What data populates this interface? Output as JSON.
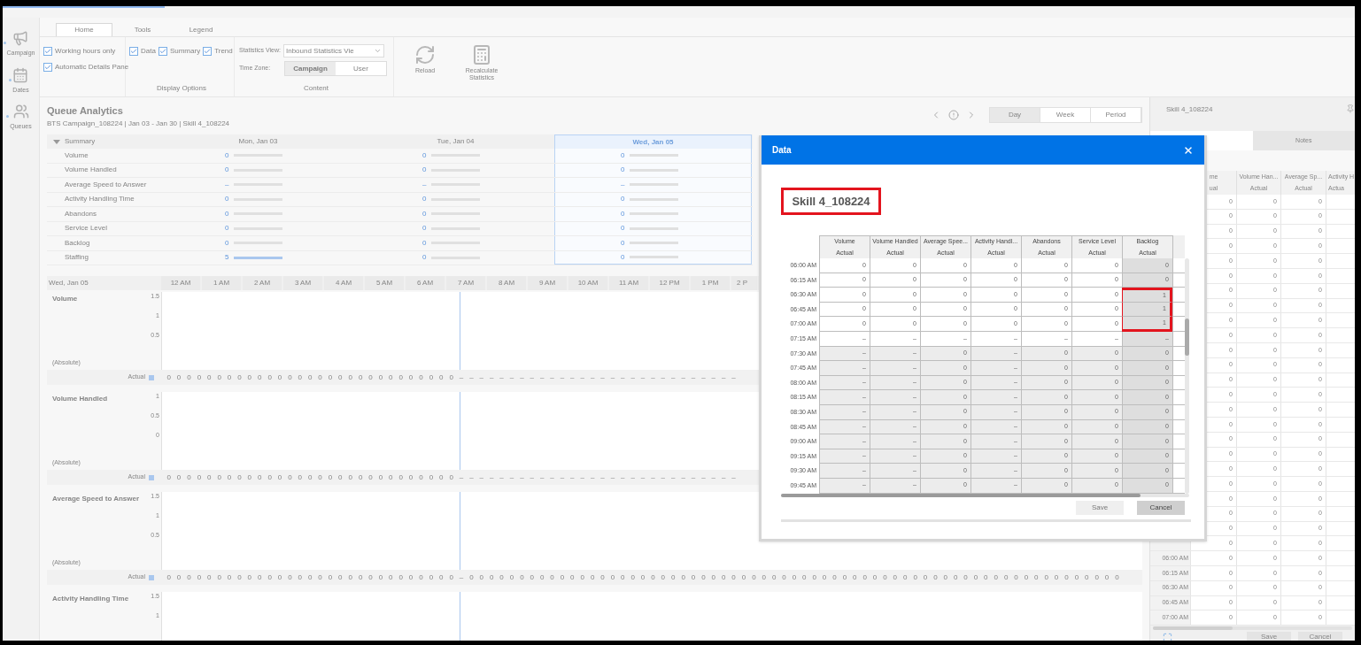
{
  "loading_bar": {
    "level": 0.12
  },
  "rail": [
    {
      "label": "Campaign",
      "kind": "campaign"
    },
    {
      "label": "Dates",
      "kind": "dates"
    },
    {
      "label": "Queues",
      "kind": "queues"
    }
  ],
  "ribbon": {
    "tabs": [
      {
        "label": "Home",
        "selected": true
      },
      {
        "label": "Tools",
        "selected": false
      },
      {
        "label": "Legend",
        "selected": false
      }
    ],
    "options": [
      {
        "label": "Working hours only",
        "checked": true
      },
      {
        "label": "Automatic Details Pane",
        "checked": true
      }
    ],
    "display_options": {
      "label": "Display Options",
      "items": [
        {
          "label": "Data",
          "checked": true
        },
        {
          "label": "Summary",
          "checked": true
        },
        {
          "label": "Trend",
          "checked": true
        }
      ]
    },
    "content": {
      "label": "Content",
      "statistics_view": {
        "label": "Statistics View:",
        "value": "Inbound Statistics Vie"
      },
      "time_zone": {
        "label": "Time Zone:",
        "options": [
          {
            "label": "Campaign",
            "selected": true
          },
          {
            "label": "User",
            "selected": false
          }
        ]
      }
    },
    "actions": [
      {
        "label": "Reload",
        "kind": "reload"
      },
      {
        "label": "Recalculate Statistics",
        "kind": "recalculate"
      }
    ]
  },
  "page": {
    "title": "Queue Analytics",
    "subtitle": "BTS Campaign_108224 | Jan 03 - Jan 30 | Skill 4_108224",
    "periods": [
      {
        "label": "Day",
        "selected": true
      },
      {
        "label": "Week",
        "selected": false
      },
      {
        "label": "Period",
        "selected": false
      }
    ]
  },
  "summary": {
    "label": "Summary",
    "expanded": true,
    "days": [
      {
        "label": "Mon, Jan 03",
        "selected": false
      },
      {
        "label": "Tue, Jan 04",
        "selected": false
      },
      {
        "label": "Wed, Jan 05",
        "selected": true
      }
    ],
    "rows": [
      {
        "label": "Volume",
        "cells": [
          {
            "value": "0",
            "level": 0
          },
          {
            "value": "0",
            "level": 0
          },
          {
            "value": "0",
            "level": 0
          }
        ]
      },
      {
        "label": "Volume Handled",
        "cells": [
          {
            "value": "0",
            "level": 0
          },
          {
            "value": "0",
            "level": 0
          },
          {
            "value": "0",
            "level": 0
          }
        ]
      },
      {
        "label": "Average Speed to Answer",
        "cells": [
          {
            "value": "–",
            "level": 0
          },
          {
            "value": "–",
            "level": 0
          },
          {
            "value": "–",
            "level": 0
          }
        ]
      },
      {
        "label": "Activity Handling Time",
        "cells": [
          {
            "value": "0",
            "level": 0
          },
          {
            "value": "0",
            "level": 0
          },
          {
            "value": "0",
            "level": 0
          }
        ]
      },
      {
        "label": "Abandons",
        "cells": [
          {
            "value": "0",
            "level": 0
          },
          {
            "value": "0",
            "level": 0
          },
          {
            "value": "0",
            "level": 0
          }
        ]
      },
      {
        "label": "Service Level",
        "cells": [
          {
            "value": "0",
            "level": 0
          },
          {
            "value": "0",
            "level": 0
          },
          {
            "value": "0",
            "level": 0
          }
        ]
      },
      {
        "label": "Backlog",
        "cells": [
          {
            "value": "0",
            "level": 0
          },
          {
            "value": "0",
            "level": 0
          },
          {
            "value": "0",
            "level": 0
          }
        ]
      },
      {
        "label": "Staffing",
        "cells": [
          {
            "value": "5",
            "level": 1
          },
          {
            "value": "0",
            "level": 0
          },
          {
            "value": "0",
            "level": 0
          }
        ]
      }
    ]
  },
  "timeline": {
    "date": "Wed, Jan 05",
    "hours": [
      "12 AM",
      "1 AM",
      "2 AM",
      "3 AM",
      "4 AM",
      "5 AM",
      "6 AM",
      "7 AM",
      "8 AM",
      "9 AM",
      "10 AM",
      "11 AM",
      "12 PM",
      "1 PM",
      "2 P"
    ],
    "charts": [
      {
        "title": "Volume",
        "scale": "(Absolute)",
        "ticks": [
          "1.5",
          "1",
          "0.5"
        ],
        "actual_label": "Actual",
        "actual": [
          "0",
          "0",
          "0",
          "0",
          "0",
          "0",
          "0",
          "0",
          "0",
          "0",
          "0",
          "0",
          "0",
          "0",
          "0",
          "0",
          "0",
          "0",
          "0",
          "0",
          "0",
          "0",
          "0",
          "0",
          "0",
          "0",
          "0",
          "0",
          "0",
          "–",
          "–",
          "–",
          "–",
          "–",
          "–",
          "–",
          "–",
          "–",
          "–",
          "–",
          "–",
          "–",
          "–",
          "–",
          "–",
          "–",
          "–",
          "–",
          "–",
          "–",
          "–",
          "–",
          "–",
          "–",
          "–",
          "–",
          "–"
        ]
      },
      {
        "title": "Volume Handled",
        "scale": "(Absolute)",
        "ticks": [
          "1",
          "0.5",
          "0"
        ],
        "actual_label": "Actual",
        "actual": [
          "0",
          "0",
          "0",
          "0",
          "0",
          "0",
          "0",
          "0",
          "0",
          "0",
          "0",
          "0",
          "0",
          "0",
          "0",
          "0",
          "0",
          "0",
          "0",
          "0",
          "0",
          "0",
          "0",
          "0",
          "0",
          "0",
          "0",
          "0",
          "0",
          "–",
          "–",
          "–",
          "–",
          "–",
          "–",
          "–",
          "–",
          "–",
          "–",
          "–",
          "–",
          "–",
          "–",
          "–",
          "–",
          "–",
          "–",
          "–",
          "–",
          "–",
          "–",
          "–",
          "–",
          "–",
          "–",
          "–",
          "–"
        ]
      },
      {
        "title": "Average Speed to Answer",
        "scale": "(Absolute)",
        "ticks": [
          "1.5",
          "1",
          "0.5"
        ],
        "actual_label": "Actual",
        "actual": [
          "0",
          "0",
          "0",
          "0",
          "0",
          "0",
          "0",
          "0",
          "0",
          "0",
          "0",
          "0",
          "0",
          "0",
          "0",
          "0",
          "0",
          "0",
          "0",
          "0",
          "0",
          "0",
          "0",
          "0",
          "0",
          "0",
          "0",
          "0",
          "0",
          "–",
          "0",
          "0",
          "0",
          "0",
          "0",
          "0",
          "0",
          "0",
          "0",
          "0",
          "0",
          "0",
          "0",
          "0",
          "0",
          "0",
          "0",
          "0",
          "0",
          "0",
          "0",
          "0",
          "0",
          "0",
          "0",
          "0",
          "0",
          "0",
          "0",
          "0",
          "0",
          "0",
          "0",
          "0",
          "0",
          "0",
          "0",
          "0",
          "0",
          "0",
          "0",
          "0",
          "0",
          "0",
          "0",
          "0",
          "0",
          "0",
          "0",
          "0",
          "0",
          "0",
          "0",
          "0",
          "0",
          "0",
          "0",
          "0",
          "0",
          "0",
          "0",
          "0",
          "0",
          "0",
          "0"
        ]
      },
      {
        "title": "Activity Handling Time",
        "ticks": [
          "1.5",
          "1"
        ]
      }
    ]
  },
  "details": {
    "title": "Skill 4_108224",
    "tabs": [
      {
        "selected": true
      },
      {
        "label": "Notes",
        "selected": false
      }
    ],
    "columns": [
      {
        "label": "me",
        "sub": "ual"
      },
      {
        "label": "Volume Han...",
        "sub": "Actual"
      },
      {
        "label": "Average Sp...",
        "sub": "Actual"
      },
      {
        "label": "Activity H",
        "sub": "Actua"
      }
    ],
    "rows": [
      {
        "values": [
          "0",
          "0",
          "0"
        ]
      },
      {
        "values": [
          "0",
          "0",
          "0"
        ]
      },
      {
        "values": [
          "0",
          "0",
          "0"
        ]
      },
      {
        "values": [
          "0",
          "0",
          "0"
        ]
      },
      {
        "values": [
          "0",
          "0",
          "0"
        ]
      },
      {
        "values": [
          "0",
          "0",
          "0"
        ]
      },
      {
        "values": [
          "0",
          "0",
          "0"
        ]
      },
      {
        "values": [
          "0",
          "0",
          "0"
        ]
      },
      {
        "values": [
          "0",
          "0",
          "0"
        ]
      },
      {
        "values": [
          "0",
          "0",
          "0"
        ]
      },
      {
        "values": [
          "0",
          "0",
          "0"
        ]
      },
      {
        "values": [
          "0",
          "0",
          "0"
        ]
      },
      {
        "values": [
          "0",
          "0",
          "0"
        ]
      },
      {
        "values": [
          "0",
          "0",
          "0"
        ]
      },
      {
        "values": [
          "0",
          "0",
          "0"
        ]
      },
      {
        "values": [
          "0",
          "0",
          "0"
        ]
      },
      {
        "values": [
          "0",
          "0",
          "0"
        ]
      },
      {
        "values": [
          "0",
          "0",
          "0"
        ]
      },
      {
        "values": [
          "0",
          "0",
          "0"
        ]
      },
      {
        "values": [
          "0",
          "0",
          "0"
        ]
      },
      {
        "values": [
          "0",
          "0",
          "0"
        ]
      },
      {
        "values": [
          "0",
          "0",
          "0"
        ]
      },
      {
        "values": [
          "0",
          "0",
          "0"
        ]
      },
      {
        "values": [
          "0",
          "0",
          "0"
        ]
      },
      {
        "time": "06:00 AM",
        "values": [
          "0",
          "0",
          "0"
        ]
      },
      {
        "time": "06:15 AM",
        "values": [
          "0",
          "0",
          "0"
        ]
      },
      {
        "time": "06:30 AM",
        "values": [
          "0",
          "0",
          "0"
        ]
      },
      {
        "time": "06:45 AM",
        "values": [
          "0",
          "0",
          "0"
        ]
      },
      {
        "time": "07:00 AM",
        "values": [
          "0",
          "0",
          "0"
        ]
      }
    ],
    "buttons": [
      "Save",
      "Cancel"
    ]
  },
  "dialog": {
    "title": "Data",
    "heading": {
      "text": "Skill 4_108224",
      "highlighted": true
    },
    "columns": [
      {
        "label": "Volume",
        "sub": "Actual",
        "shaded": false
      },
      {
        "label": "Volume Handled",
        "sub": "Actual",
        "shaded": false
      },
      {
        "label": "Average Spee...",
        "sub": "Actual",
        "shaded": false
      },
      {
        "label": "Activity Handl...",
        "sub": "Actual",
        "shaded": false
      },
      {
        "label": "Abandons",
        "sub": "Actual",
        "shaded": false
      },
      {
        "label": "Service Level",
        "sub": "Actual",
        "shaded": false
      },
      {
        "label": "Backlog",
        "sub": "Actual",
        "shaded": true
      }
    ],
    "rows": [
      {
        "time": "06:00 AM",
        "shaded": false,
        "highlighted": false,
        "values": [
          "0",
          "0",
          "0",
          "0",
          "0",
          "0",
          "0"
        ]
      },
      {
        "time": "06:15 AM",
        "shaded": false,
        "highlighted": false,
        "values": [
          "0",
          "0",
          "0",
          "0",
          "0",
          "0",
          "0"
        ]
      },
      {
        "time": "06:30 AM",
        "shaded": false,
        "highlighted": true,
        "values": [
          "0",
          "0",
          "0",
          "0",
          "0",
          "0",
          "1"
        ]
      },
      {
        "time": "06:45 AM",
        "shaded": false,
        "highlighted": true,
        "values": [
          "0",
          "0",
          "0",
          "0",
          "0",
          "0",
          "1"
        ]
      },
      {
        "time": "07:00 AM",
        "shaded": false,
        "highlighted": true,
        "values": [
          "0",
          "0",
          "0",
          "0",
          "0",
          "0",
          "1"
        ]
      },
      {
        "time": "07:15 AM",
        "shaded": false,
        "highlighted": false,
        "values": [
          "–",
          "–",
          "–",
          "–",
          "–",
          "–",
          "–"
        ]
      },
      {
        "time": "07:30 AM",
        "shaded": true,
        "highlighted": false,
        "values": [
          "–",
          "–",
          "0",
          "–",
          "0",
          "0",
          "0"
        ]
      },
      {
        "time": "07:45 AM",
        "shaded": true,
        "highlighted": false,
        "values": [
          "–",
          "–",
          "0",
          "–",
          "0",
          "0",
          "0"
        ]
      },
      {
        "time": "08:00 AM",
        "shaded": true,
        "highlighted": false,
        "values": [
          "–",
          "–",
          "0",
          "–",
          "0",
          "0",
          "0"
        ]
      },
      {
        "time": "08:15 AM",
        "shaded": true,
        "highlighted": false,
        "values": [
          "–",
          "–",
          "0",
          "–",
          "0",
          "0",
          "0"
        ]
      },
      {
        "time": "08:30 AM",
        "shaded": true,
        "highlighted": false,
        "values": [
          "–",
          "–",
          "0",
          "–",
          "0",
          "0",
          "0"
        ]
      },
      {
        "time": "08:45 AM",
        "shaded": true,
        "highlighted": false,
        "values": [
          "–",
          "–",
          "0",
          "–",
          "0",
          "0",
          "0"
        ]
      },
      {
        "time": "09:00 AM",
        "shaded": true,
        "highlighted": false,
        "values": [
          "–",
          "–",
          "0",
          "–",
          "0",
          "0",
          "0"
        ]
      },
      {
        "time": "09:15 AM",
        "shaded": true,
        "highlighted": false,
        "values": [
          "–",
          "–",
          "0",
          "–",
          "0",
          "0",
          "0"
        ]
      },
      {
        "time": "09:30 AM",
        "shaded": true,
        "highlighted": false,
        "values": [
          "–",
          "–",
          "0",
          "–",
          "0",
          "0",
          "0"
        ]
      },
      {
        "time": "09:45 AM",
        "shaded": true,
        "highlighted": false,
        "values": [
          "–",
          "–",
          "0",
          "–",
          "0",
          "0",
          "0"
        ]
      }
    ],
    "buttons": [
      {
        "label": "Save",
        "kind": "secondary"
      },
      {
        "label": "Cancel",
        "kind": "primary"
      }
    ]
  }
}
